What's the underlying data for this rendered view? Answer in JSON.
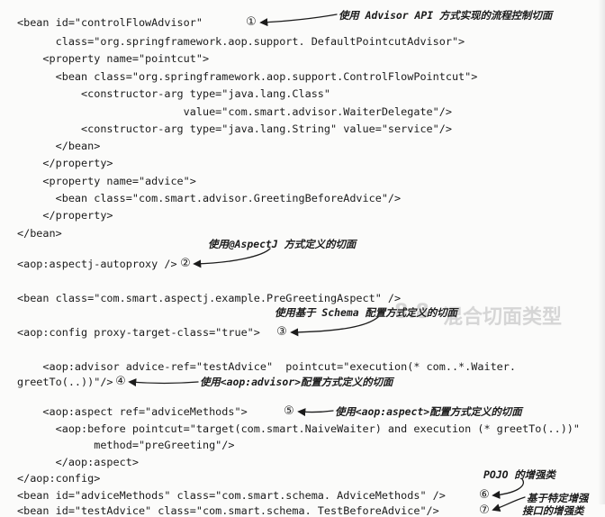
{
  "code_lines": [
    "<bean id=\"controlFlowAdvisor\"",
    "      class=\"org.springframework.aop.support. DefaultPointcutAdvisor\">",
    "    <property name=\"pointcut\">",
    "      <bean class=\"org.springframework.aop.support.ControlFlowPointcut\">",
    "          <constructor-arg type=\"java.lang.Class\"",
    "                          value=\"com.smart.advisor.WaiterDelegate\"/>",
    "          <constructor-arg type=\"java.lang.String\" value=\"service\"/>",
    "      </bean>",
    "    </property>",
    "    <property name=\"advice\">",
    "      <bean class=\"com.smart.advisor.GreetingBeforeAdvice\"/>",
    "    </property>",
    "</bean>",
    "<aop:aspectj-autoproxy />",
    "<bean class=\"com.smart.aspectj.example.PreGreetingAspect\" />",
    "<aop:config proxy-target-class=\"true\">",
    "    <aop:advisor advice-ref=\"testAdvice\"  pointcut=\"execution(* com..*.Waiter.",
    "greetTo(..))\"/>",
    "    <aop:aspect ref=\"adviceMethods\">",
    "      <aop:before pointcut=\"target(com.smart.NaiveWaiter) and execution (* greetTo(..))\"",
    "            method=\"preGreeting\"/>",
    "      </aop:aspect>",
    "</aop:config>",
    "<bean id=\"adviceMethods\" class=\"com.smart.schema. AdviceMethods\" />",
    "<bean id=\"testAdvice\" class=\"com.smart.schema. TestBeforeAdvice\"/>"
  ],
  "markers": [
    "①",
    "②",
    "③",
    "④",
    "⑤",
    "⑥",
    "⑦"
  ],
  "annotations": [
    "使用 Advisor API 方式实现的流程控制切面",
    "使用@AspectJ 方式定义的切面",
    "使用基于 Schema 配置方式定义的切面",
    "使用<aop:advisor>配置方式定义的切面",
    "使用<aop:aspect>配置方式定义的切面",
    "POJO 的增强类",
    "基于特定增强",
    "接口的增强类"
  ],
  "bleed_text": [
    "8.8",
    "混合切面类型"
  ]
}
